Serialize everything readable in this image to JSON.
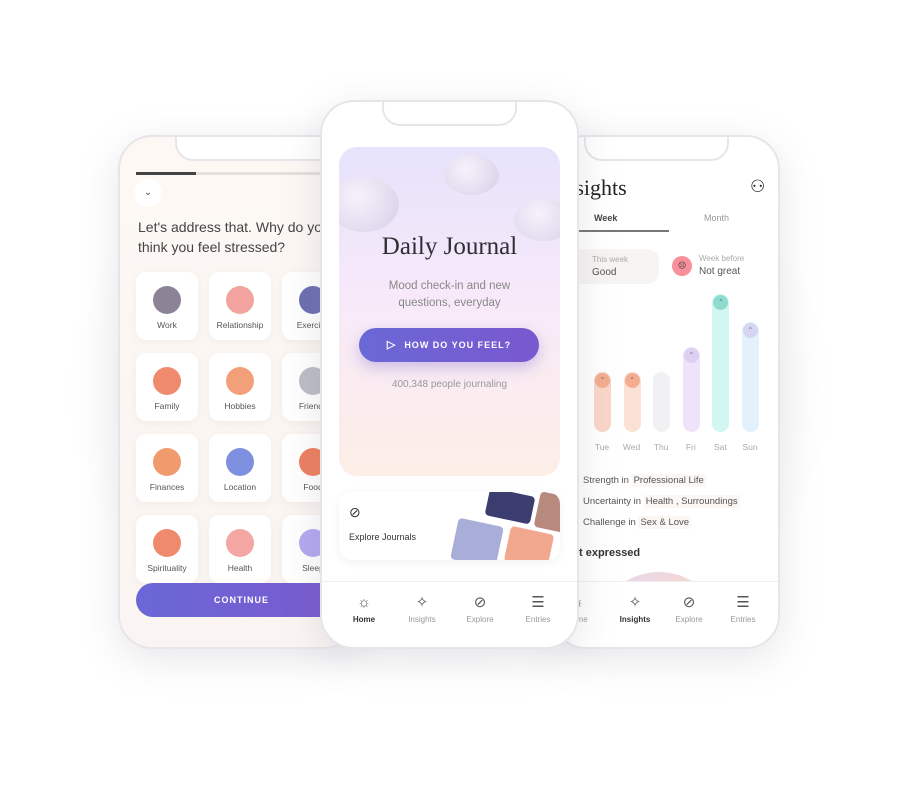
{
  "left": {
    "progress_percent": 30,
    "question": "Let's address that. Why do you think you feel stressed?",
    "categories": [
      {
        "label": "Work",
        "color": "#8d8396"
      },
      {
        "label": "Relationship",
        "color": "#f3a3a0"
      },
      {
        "label": "Exercise",
        "color": "#6b6fb0"
      },
      {
        "label": "Family",
        "color": "#f08a6c"
      },
      {
        "label": "Hobbies",
        "color": "#f2a07a"
      },
      {
        "label": "Friends",
        "color": "#bdbdc7"
      },
      {
        "label": "Finances",
        "color": "#ef9b6d"
      },
      {
        "label": "Location",
        "color": "#7f8fe0"
      },
      {
        "label": "Food",
        "color": "#ee7f5f"
      },
      {
        "label": "Spirituality",
        "color": "#f08a6c"
      },
      {
        "label": "Health",
        "color": "#f4a7a2"
      },
      {
        "label": "Sleep",
        "color": "#b3a8f0"
      }
    ],
    "continue": "CONTINUE"
  },
  "center": {
    "title": "Daily Journal",
    "subtitle_line1": "Mood check-in and new",
    "subtitle_line2": "questions, everyday",
    "cta": "HOW DO YOU FEEL?",
    "count": "400,348 people journaling",
    "explore": "Explore Journals",
    "nav": [
      {
        "label": "Home",
        "icon": "sun-icon"
      },
      {
        "label": "Insights",
        "icon": "sparkle-icon"
      },
      {
        "label": "Explore",
        "icon": "compass-icon"
      },
      {
        "label": "Entries",
        "icon": "entries-icon"
      }
    ]
  },
  "right": {
    "title": "Insights",
    "tabs": [
      "Week",
      "Month"
    ],
    "this_week_label": "This week",
    "this_week_value": "Good",
    "week_before_label": "Week before",
    "week_before_value": "Not great",
    "mood_chart": {
      "days": [
        "Tue",
        "Wed",
        "Thu",
        "Fri",
        "Sat",
        "Sun"
      ],
      "levels": [
        2,
        2,
        2,
        3,
        5,
        4
      ],
      "colors": [
        "#f9d6c8",
        "#fbe0d4",
        "#f1f1f3",
        "#efe3fb",
        "#d2f6f1",
        "#e3f1fd"
      ],
      "face_colors": [
        "#f4ac8e",
        "#f4ac8e",
        "",
        "#dcd0f2",
        "#8fdccf",
        "#d6d6f2"
      ]
    },
    "tags": [
      [
        "Strength in ",
        "Professional Life"
      ],
      [
        "Uncertainty in ",
        "Health , Surroundings"
      ],
      [
        "Challenge in ",
        "Sex & Love"
      ]
    ],
    "section": "Most expressed",
    "nav": [
      {
        "label": "Home",
        "icon": "sun-icon"
      },
      {
        "label": "Insights",
        "icon": "sparkle-icon"
      },
      {
        "label": "Explore",
        "icon": "compass-icon"
      },
      {
        "label": "Entries",
        "icon": "entries-icon"
      }
    ]
  },
  "colors": {
    "accent": "#6a5fd6"
  }
}
